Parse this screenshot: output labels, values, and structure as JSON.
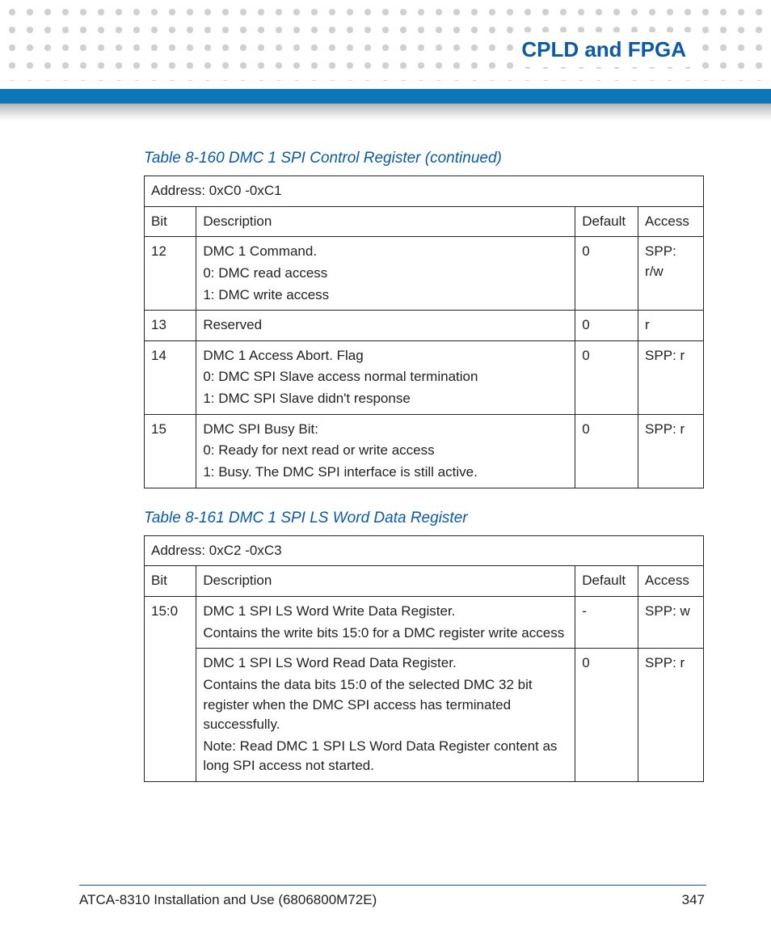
{
  "chapter_title": "CPLD and FPGA",
  "footer": {
    "doc": "ATCA-8310 Installation and Use (6806800M72E)",
    "page": "347"
  },
  "table1": {
    "caption": "Table 8-160 DMC 1 SPI Control Register (continued)",
    "address": "Address: 0xC0 -0xC1",
    "hdr": {
      "bit": "Bit",
      "desc": "Description",
      "def": "Default",
      "acc": "Access"
    },
    "rows": [
      {
        "bit": "12",
        "l1": "DMC 1 Command.",
        "l2": "0: DMC read access",
        "l3": "1: DMC write access",
        "def": "0",
        "acc": "SPP: r/w"
      },
      {
        "bit": "13",
        "l1": "Reserved",
        "l2": "",
        "l3": "",
        "def": "0",
        "acc": "r"
      },
      {
        "bit": "14",
        "l1": "DMC 1 Access Abort. Flag",
        "l2": "0: DMC SPI Slave access normal termination",
        "l3": "1: DMC SPI Slave didn't response",
        "def": "0",
        "acc": "SPP: r"
      },
      {
        "bit": "15",
        "l1": "DMC SPI Busy Bit:",
        "l2": "0: Ready for next read or write access",
        "l3": "1: Busy. The DMC SPI interface is still active.",
        "def": "0",
        "acc": "SPP: r"
      }
    ]
  },
  "table2": {
    "caption": "Table 8-161 DMC 1 SPI LS Word Data Register",
    "address": "Address: 0xC2 -0xC3",
    "hdr": {
      "bit": "Bit",
      "desc": "Description",
      "def": "Default",
      "acc": "Access"
    },
    "row_bit": "15:0",
    "sub1": {
      "l1": "DMC 1 SPI LS Word Write Data Register.",
      "l2": "Contains the write bits 15:0 for a DMC register write access",
      "def": "-",
      "acc": "SPP: w"
    },
    "sub2": {
      "l1": "DMC 1 SPI LS Word Read Data Register.",
      "l2": "Contains the data bits 15:0 of the selected DMC 32 bit register when the DMC SPI access has terminated successfully.",
      "l3": "Note: Read DMC 1 SPI LS Word Data Register content as long SPI access not started.",
      "def": "0",
      "acc": "SPP: r"
    }
  }
}
